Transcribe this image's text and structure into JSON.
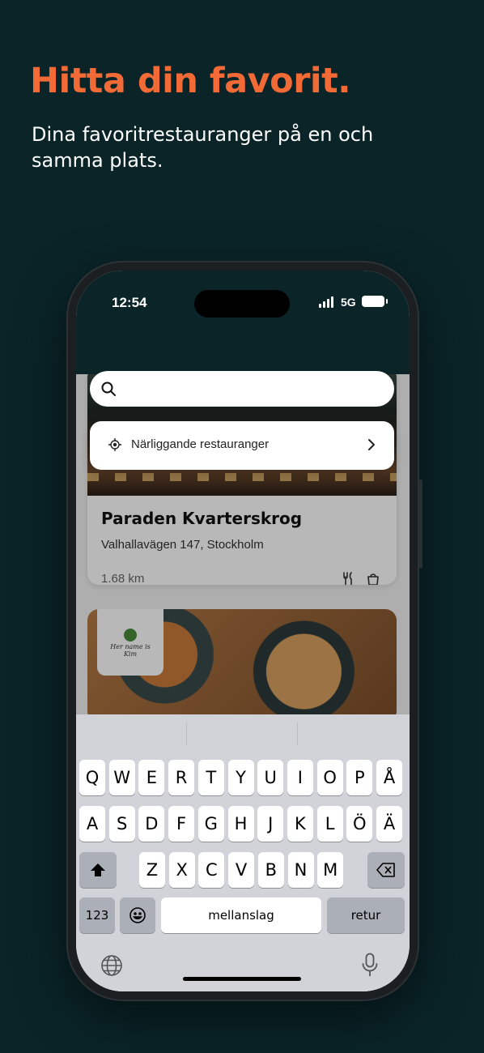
{
  "promo": {
    "headline": "Hitta din favorit.",
    "subline": "Dina favoritrestauranger på en och samma plats."
  },
  "colors": {
    "background": "#0a2428",
    "accent": "#f26a35"
  },
  "status_bar": {
    "time": "12:54",
    "network": "5G"
  },
  "search": {
    "placeholder": "",
    "value": ""
  },
  "suggestion": {
    "label": "Närliggande restauranger",
    "icon": "location-target-icon"
  },
  "restaurants": [
    {
      "name": "Paraden Kvarterskrog",
      "address": "Valhallavägen 147, Stockholm",
      "distance": "1.68 km",
      "icons": [
        "cutlery-icon",
        "bag-icon"
      ]
    },
    {
      "logo_text": "Her name is Kim"
    }
  ],
  "keyboard": {
    "row1": [
      "Q",
      "W",
      "E",
      "R",
      "T",
      "Y",
      "U",
      "I",
      "O",
      "P",
      "Å"
    ],
    "row2": [
      "A",
      "S",
      "D",
      "F",
      "G",
      "H",
      "J",
      "K",
      "L",
      "Ö",
      "Ä"
    ],
    "row3": [
      "Z",
      "X",
      "C",
      "V",
      "B",
      "N",
      "M"
    ],
    "numbers_label": "123",
    "space_label": "mellanslag",
    "return_label": "retur"
  }
}
